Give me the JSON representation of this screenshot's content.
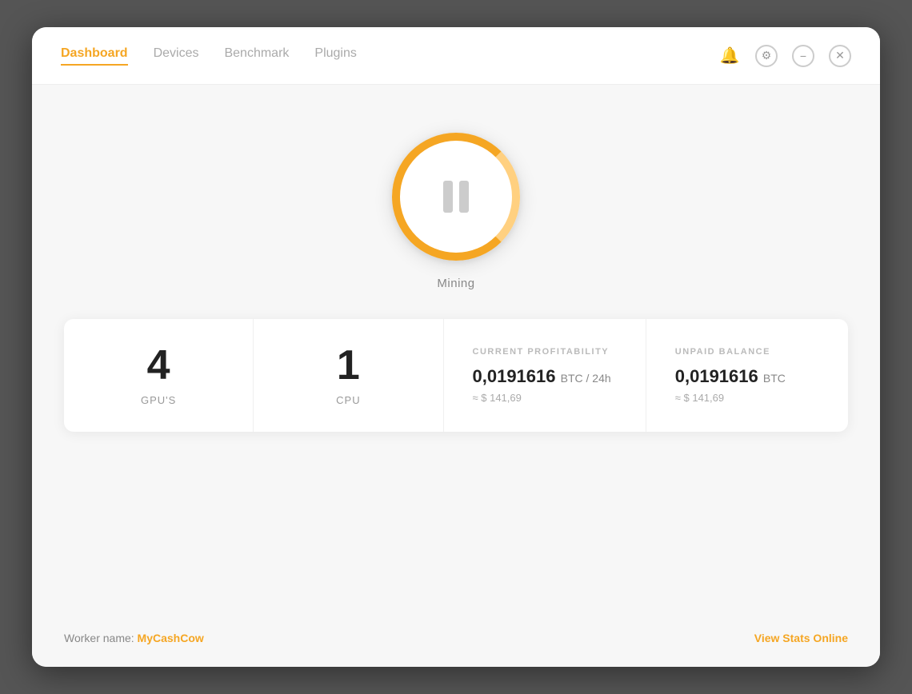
{
  "nav": {
    "items": [
      {
        "label": "Dashboard",
        "active": true
      },
      {
        "label": "Devices",
        "active": false
      },
      {
        "label": "Benchmark",
        "active": false
      },
      {
        "label": "Plugins",
        "active": false
      }
    ]
  },
  "mining": {
    "status_label": "Mining"
  },
  "stats": {
    "gpu_count": "4",
    "gpu_label": "GPU'S",
    "cpu_count": "1",
    "cpu_label": "CPU",
    "profitability": {
      "title": "CURRENT PROFITABILITY",
      "value": "0,0191616",
      "unit": "BTC / 24h",
      "approx": "≈ $ 141,69"
    },
    "balance": {
      "title": "UNPAID BALANCE",
      "value": "0,0191616",
      "unit": "BTC",
      "approx": "≈ $ 141,69"
    }
  },
  "footer": {
    "worker_prefix": "Worker name: ",
    "worker_name": "MyCashCow",
    "view_stats": "View Stats Online"
  },
  "colors": {
    "accent": "#f5a623",
    "text_dark": "#222",
    "text_muted": "#999",
    "text_light": "#bbb"
  }
}
